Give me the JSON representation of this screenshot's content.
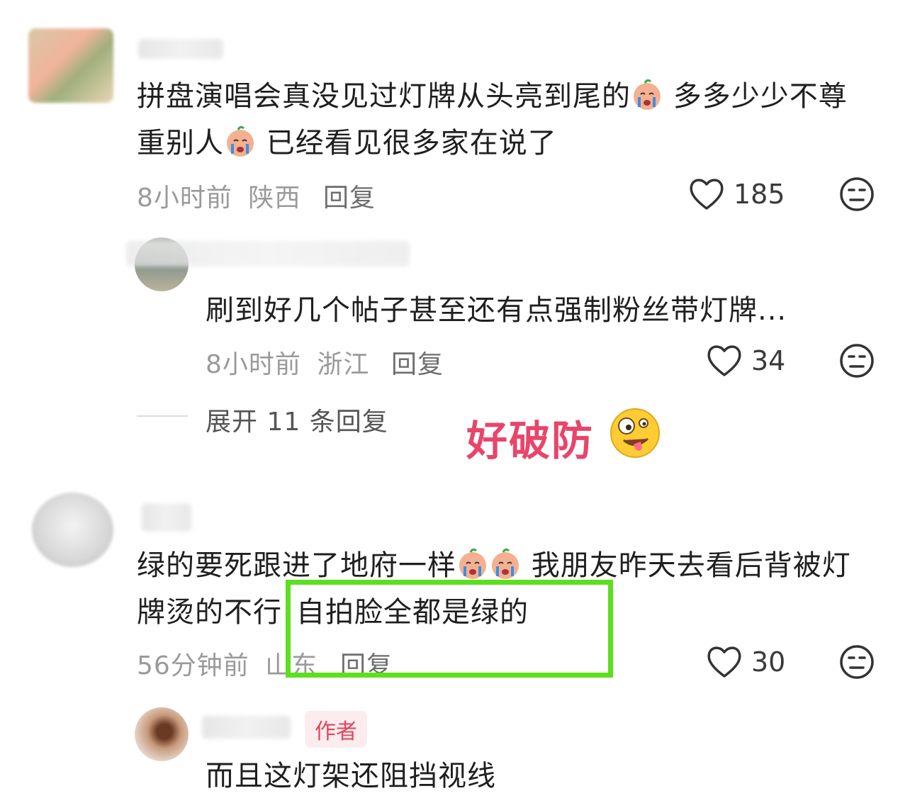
{
  "comments": [
    {
      "text_a": "拼盘演唱会真没见过灯牌从头亮到尾的",
      "text_b": "多多少少不尊",
      "text_c": "重别人",
      "text_d": "已经看见很多家在说了",
      "time": "8小时前",
      "location": "陕西",
      "reply_label": "回复",
      "likes": "185"
    },
    {
      "text": "刷到好几个帖子甚至还有点强制粉丝带灯牌...",
      "time": "8小时前",
      "location": "浙江",
      "reply_label": "回复",
      "likes": "34"
    },
    {
      "text_a": "绿的要死跟进了地府一样",
      "text_b": "我朋友昨天去看后背被灯",
      "text_c": "牌烫的不行",
      "text_d": "自拍脸全都是绿的",
      "time": "56分钟前",
      "location": "山东",
      "reply_label": "回复",
      "likes": "30"
    },
    {
      "author_badge": "作者",
      "text": "而且这灯架还阻挡视线"
    }
  ],
  "expand_replies": "展开 11 条回复",
  "overlay_caption": "好破防",
  "colors": {
    "highlight_box": "#5be01e",
    "caption": "#e8456a",
    "author_badge": "#e0455c"
  },
  "icons": [
    "heart-icon",
    "dislike-face-icon",
    "crying-emoji-icon",
    "zany-face-emoji-icon"
  ]
}
